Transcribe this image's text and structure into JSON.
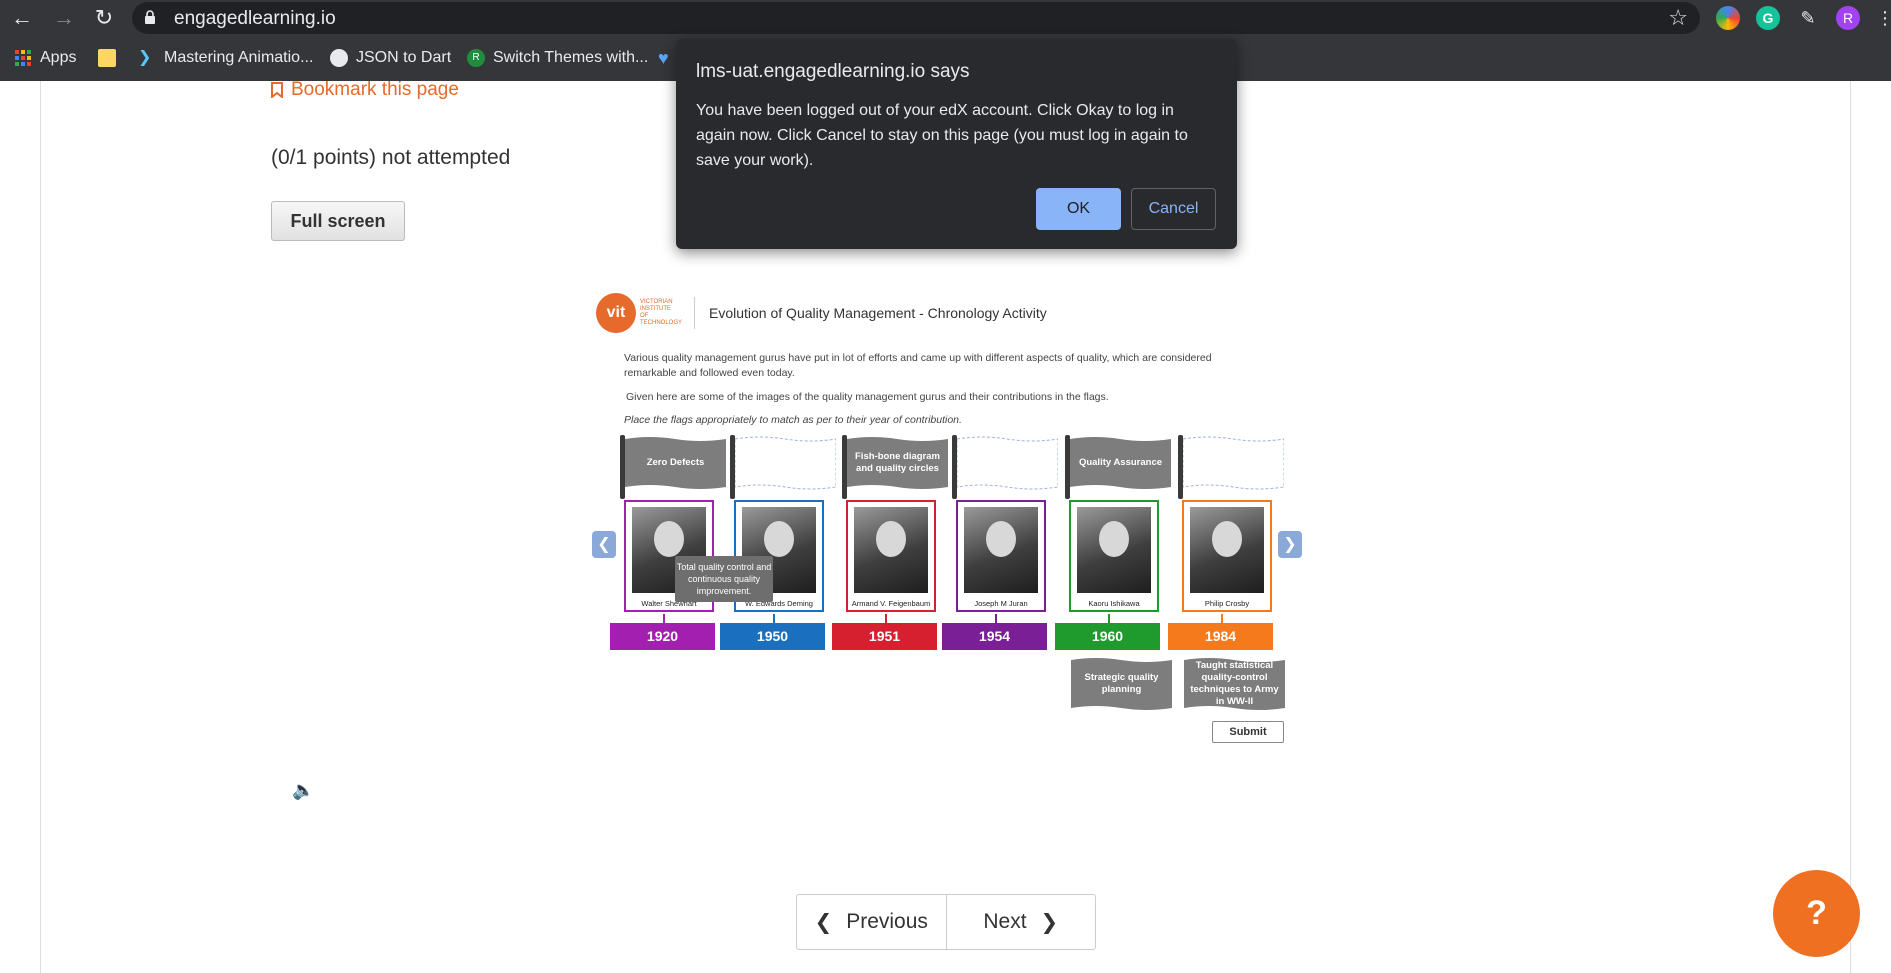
{
  "browser": {
    "url": "engagedlearning.io",
    "bookmarks": [
      {
        "label": "Apps",
        "icon": "apps-grid-icon"
      },
      {
        "label": "",
        "icon": "note-icon"
      },
      {
        "label": "Mastering Animatio...",
        "icon": "flutter-icon"
      },
      {
        "label": "JSON to Dart",
        "icon": "globe-icon"
      },
      {
        "label": "Switch Themes with...",
        "icon": "r-badge-icon"
      },
      {
        "label": "",
        "icon": "heart-icon"
      }
    ],
    "profile_initial": "R"
  },
  "page": {
    "bookmark_label": "Bookmark this page",
    "points_text": "(0/1 points) not attempted",
    "fullscreen_label": "Full screen"
  },
  "activity": {
    "logo_letters": "vit",
    "logo_text": "VICTORIAN INSTITUTE OF TECHNOLOGY",
    "title": "Evolution of Quality Management - Chronology Activity",
    "desc": "Various quality management gurus have put in lot of efforts and came up with different aspects of quality, which are considered remarkable and followed even today.",
    "desc2": "Given here are some of the images of the quality management gurus and their contributions in the flags.",
    "instruction": "Place the flags appropriately to match as per to their year of contribution.",
    "placed_flags": [
      "Zero Defects",
      "",
      "Fish-bone diagram and quality circles",
      "",
      "Quality Assurance",
      ""
    ],
    "gurus": [
      {
        "name": "Walter Shewhart",
        "color": "#a21fb0"
      },
      {
        "name": "W. Edwards Deming",
        "color": "#1a6fbf"
      },
      {
        "name": "Armand V. Feigenbaum",
        "color": "#d6202f"
      },
      {
        "name": "Joseph M Juran",
        "color": "#7b1f96"
      },
      {
        "name": "Kaoru Ishikawa",
        "color": "#1f9a2c"
      },
      {
        "name": "Philip Crosby",
        "color": "#f47a1c"
      }
    ],
    "years": [
      "1920",
      "1950",
      "1951",
      "1954",
      "1960",
      "1984"
    ],
    "tooltip": "Total quality control and continuous quality improvement.",
    "pool_flags": [
      "Strategic quality planning",
      "Taught statistical quality-control techniques to Army in WW-II"
    ],
    "submit_label": "Submit"
  },
  "nav": {
    "previous_label": "Previous",
    "next_label": "Next"
  },
  "help_label": "?",
  "dialog": {
    "title": "lms-uat.engagedlearning.io says",
    "message": "You have been logged out of your edX account. Click Okay to log in again now. Click Cancel to stay on this page (you must log in again to save your work).",
    "ok_label": "OK",
    "cancel_label": "Cancel"
  }
}
